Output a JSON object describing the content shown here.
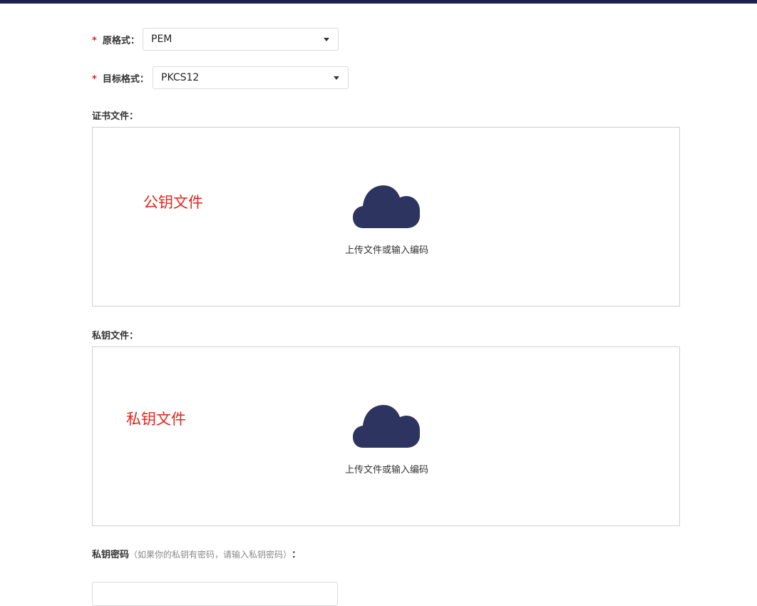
{
  "source_format": {
    "label": "原格式：",
    "value": "PEM"
  },
  "target_format": {
    "label": "目标格式：",
    "value": "PKCS12"
  },
  "required_mark": "*",
  "cert_file": {
    "label": "证书文件：",
    "overlay": "公钥文件",
    "upload_text": "上传文件或输入编码",
    "icon": "cloud-upload-icon"
  },
  "private_key_file": {
    "label": "私钥文件：",
    "overlay": "私钥文件",
    "upload_text": "上传文件或输入编码",
    "icon": "cloud-upload-icon"
  },
  "private_key_password": {
    "label": "私钥密码",
    "hint": "（如果你的私钥有密码，请输入私钥密码）",
    "colon": "：",
    "value": ""
  },
  "colors": {
    "top_bar": "#1c2150",
    "icon": "#2e3460",
    "required": "#e0201c",
    "overlay": "#e0261c"
  }
}
